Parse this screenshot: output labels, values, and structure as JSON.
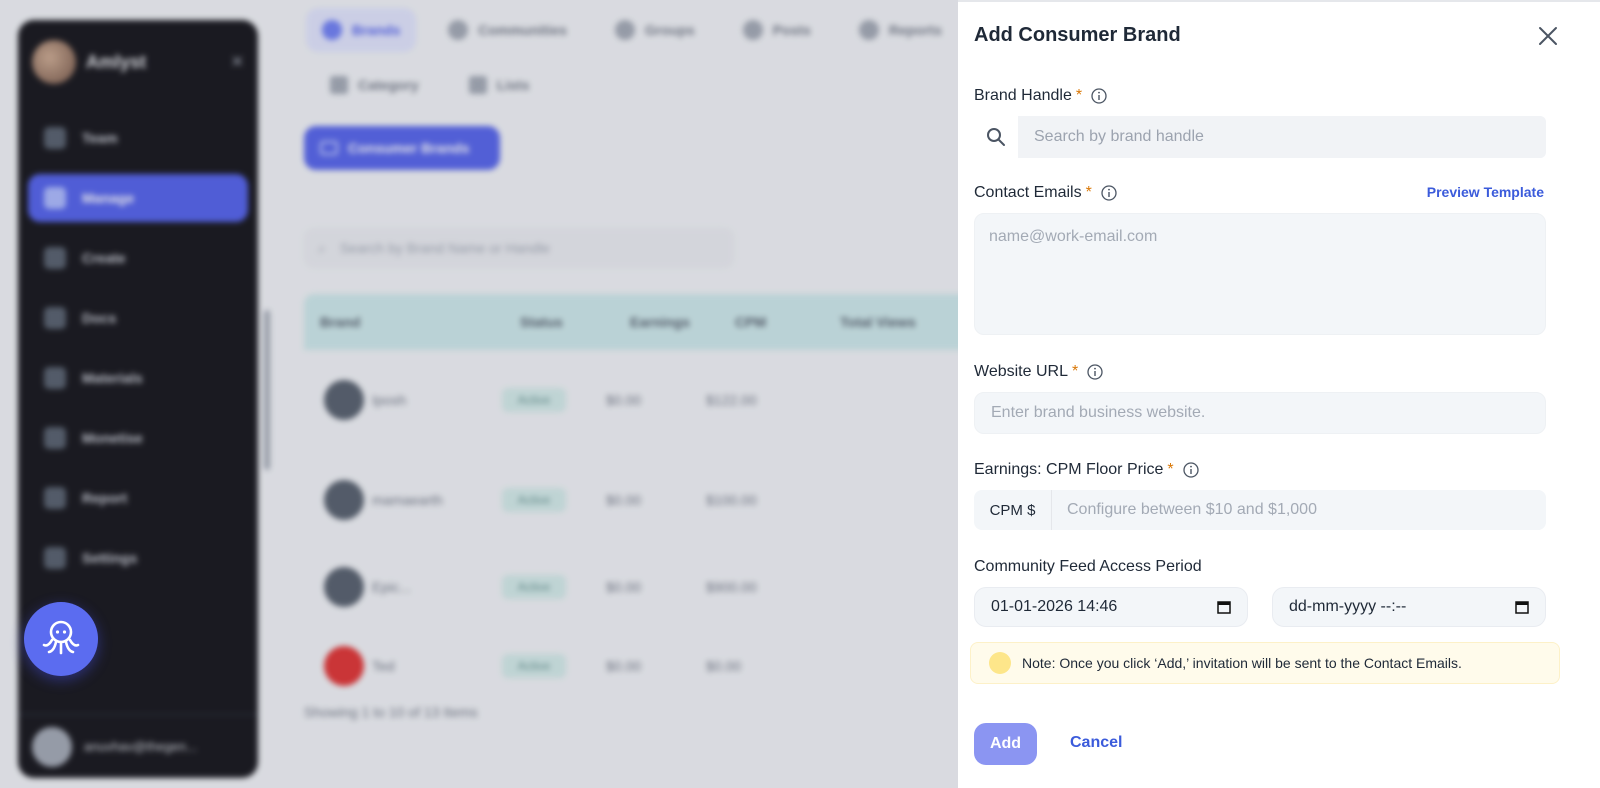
{
  "background": {
    "sidebar": {
      "title": "Amlyst",
      "items": [
        "Team",
        "Manage",
        "Create",
        "Docs",
        "Materials",
        "Monetise",
        "Report",
        "Settings"
      ],
      "user": "anuvhav@thegen..."
    },
    "tabs": [
      "Brands",
      "Communities",
      "Groups",
      "Posts",
      "Reports"
    ],
    "subtabs": [
      "Category",
      "Lists"
    ],
    "consumer_brands_button": "Consumer Brands",
    "search_placeholder": "Search by Brand Name or Handle",
    "table": {
      "headers": [
        "Brand",
        "Status",
        "Earnings",
        "CPM",
        "Total Views"
      ],
      "rows": [
        {
          "name": "Iposh",
          "status": "Active",
          "earnings": "$0.00",
          "cpm": "$122.00"
        },
        {
          "name": "mamaearth",
          "status": "Active",
          "earnings": "$0.00",
          "cpm": "$100.00"
        },
        {
          "name": "Epic...",
          "status": "Active",
          "earnings": "$0.00",
          "cpm": "$900.00"
        },
        {
          "name": "Ted",
          "status": "Active",
          "earnings": "$0.00",
          "cpm": "$0.00"
        }
      ],
      "footer": "Showing 1 to 10 of 13 Items"
    }
  },
  "drawer": {
    "title": "Add Consumer Brand",
    "brand_handle": {
      "label": "Brand Handle",
      "required": "*",
      "placeholder": "Search by brand handle"
    },
    "contact_emails": {
      "label": "Contact Emails",
      "required": "*",
      "preview_link": "Preview Template",
      "placeholder": "name@work-email.com"
    },
    "website_url": {
      "label": "Website URL",
      "required": "*",
      "placeholder": "Enter brand business website."
    },
    "cpm_floor": {
      "label": "Earnings: CPM Floor Price",
      "required": "*",
      "prefix": "CPM $",
      "placeholder": "Configure between $10 and $1,000"
    },
    "access_period": {
      "label": "Community Feed Access Period",
      "start_value": "01-01-2026 14:46",
      "end_placeholder": "dd-mm-yyyy --:--"
    },
    "note": "Note: Once you click ‘Add,’ invitation will be sent to the Contact Emails.",
    "add_label": "Add",
    "cancel_label": "Cancel"
  },
  "colors": {
    "accent": "#4757e8",
    "link": "#3b5bdb",
    "add_button": "#8b95f2",
    "required_star": "#d97706",
    "note_bg": "#fffbeb"
  }
}
